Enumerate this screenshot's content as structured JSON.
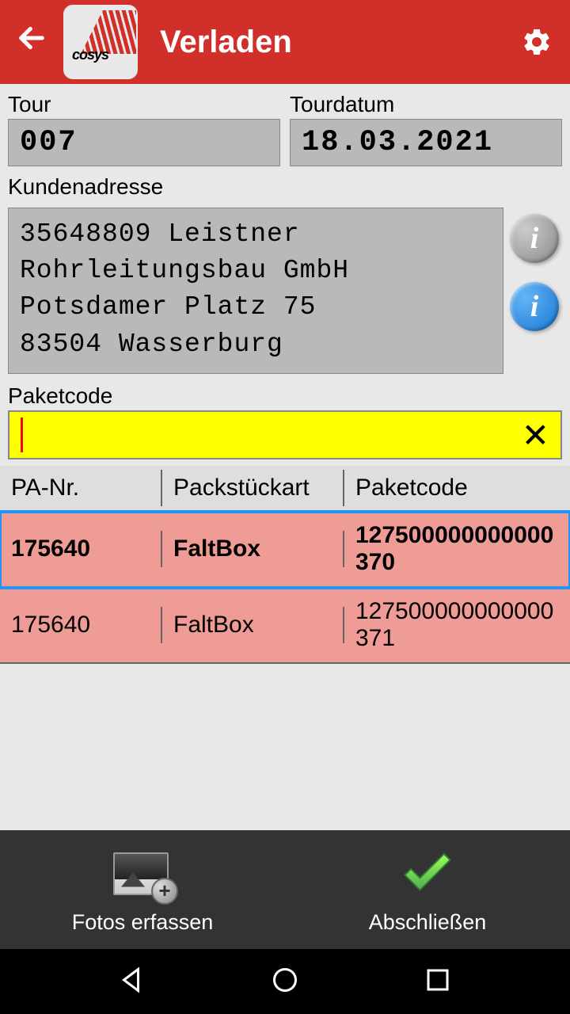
{
  "header": {
    "title": "Verladen",
    "logo_text": "cosys"
  },
  "form": {
    "tour_label": "Tour",
    "tour_value": "007",
    "tourdatum_label": "Tourdatum",
    "tourdatum_value": "18.03.2021",
    "kundenadresse_label": "Kundenadresse",
    "kundenadresse_value": "35648809 Leistner Rohrleitungsbau GmbH\nPotsdamer Platz 75\n83504 Wasserburg",
    "paketcode_label": "Paketcode",
    "paketcode_value": ""
  },
  "table": {
    "headers": {
      "pa_nr": "PA-Nr.",
      "packstueckart": "Packstückart",
      "paketcode": "Paketcode"
    },
    "rows": [
      {
        "pa_nr": "175640",
        "packstueckart": "FaltBox",
        "paketcode": "127500000000000370",
        "selected": true
      },
      {
        "pa_nr": "175640",
        "packstueckart": "FaltBox",
        "paketcode": "127500000000000371",
        "selected": false
      }
    ]
  },
  "bottom": {
    "fotos_label": "Fotos erfassen",
    "abschliessen_label": "Abschließen"
  }
}
